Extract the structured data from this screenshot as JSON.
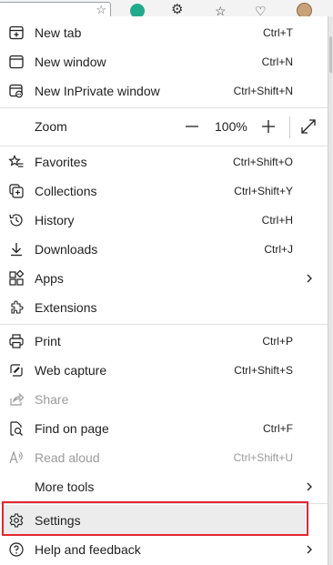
{
  "menu": {
    "new_tab": {
      "label": "New tab",
      "shortcut": "Ctrl+T",
      "icon": "new-tab-icon"
    },
    "new_window": {
      "label": "New window",
      "shortcut": "Ctrl+N",
      "icon": "new-window-icon"
    },
    "new_inprivate": {
      "label": "New InPrivate window",
      "shortcut": "Ctrl+Shift+N",
      "icon": "inprivate-icon"
    },
    "zoom": {
      "label": "Zoom",
      "value": "100%",
      "minus": "—",
      "plus": "+"
    },
    "favorites": {
      "label": "Favorites",
      "shortcut": "Ctrl+Shift+O",
      "icon": "favorites-icon"
    },
    "collections": {
      "label": "Collections",
      "shortcut": "Ctrl+Shift+Y",
      "icon": "collections-icon"
    },
    "history": {
      "label": "History",
      "shortcut": "Ctrl+H",
      "icon": "history-icon"
    },
    "downloads": {
      "label": "Downloads",
      "shortcut": "Ctrl+J",
      "icon": "download-icon"
    },
    "apps": {
      "label": "Apps",
      "icon": "apps-icon"
    },
    "extensions": {
      "label": "Extensions",
      "icon": "extensions-icon"
    },
    "print": {
      "label": "Print",
      "shortcut": "Ctrl+P",
      "icon": "print-icon"
    },
    "web_capture": {
      "label": "Web capture",
      "shortcut": "Ctrl+Shift+S",
      "icon": "web-capture-icon"
    },
    "share": {
      "label": "Share",
      "icon": "share-icon"
    },
    "find": {
      "label": "Find on page",
      "shortcut": "Ctrl+F",
      "icon": "find-icon"
    },
    "read_aloud": {
      "label": "Read aloud",
      "shortcut": "Ctrl+Shift+U",
      "icon": "read-aloud-icon"
    },
    "more_tools": {
      "label": "More tools"
    },
    "settings": {
      "label": "Settings",
      "icon": "gear-icon"
    },
    "help": {
      "label": "Help and feedback",
      "icon": "help-icon"
    }
  },
  "colors": {
    "highlight": "#e3262f",
    "menu_bg": "#ffffff",
    "hover_bg": "#ececec"
  }
}
